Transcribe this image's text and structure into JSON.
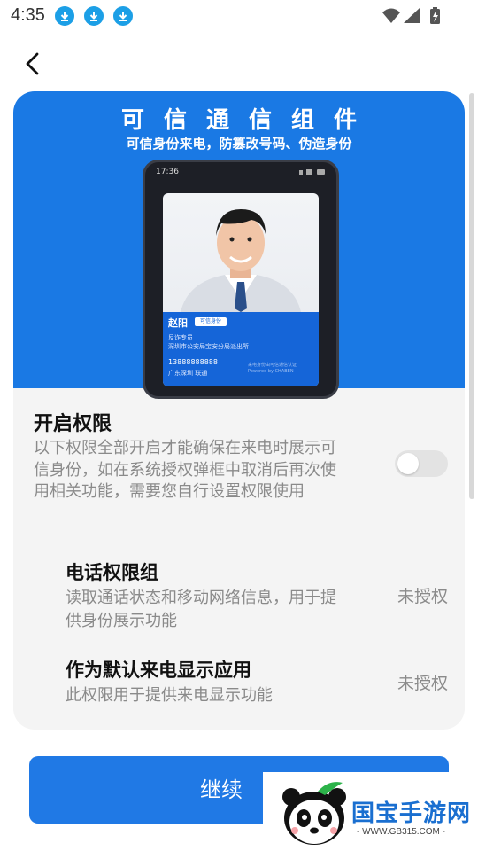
{
  "status_bar": {
    "time": "4:35"
  },
  "banner": {
    "title": "可信通信组件",
    "subtitle": "可信身份来电，防篡改号码、伪造身份",
    "phone_time": "17:36",
    "caller": {
      "name": "赵阳",
      "badge": "可信身份",
      "role": "反诈专员",
      "org": "深圳市公安局宝安分局派出所",
      "number": "13888888888",
      "location": "广东深圳 联通",
      "footer_line1": "来电身份由可信通信认证",
      "footer_line2": "Powered by CHABEN"
    }
  },
  "permissions": {
    "title": "开启权限",
    "description": "以下权限全部开启才能确保在来电时展示可信身份，如在系统授权弹框中取消后再次使用相关功能，需要您自行设置权限使用",
    "master_toggle_on": false,
    "items": [
      {
        "title": "电话权限组",
        "description": "读取通话状态和移动网络信息，用于提供身份展示功能",
        "status": "未授权"
      },
      {
        "title": "作为默认来电显示应用",
        "description": "此权限用于提供来电显示功能",
        "status": "未授权"
      }
    ]
  },
  "continue_button": {
    "label": "继续"
  },
  "watermark": {
    "brand": "国宝手游网",
    "url": "- WWW.GB315.COM -"
  },
  "colors": {
    "primary": "#2079e5",
    "banner": "#1a79e4",
    "toggle_off": "#e3e3e3"
  }
}
